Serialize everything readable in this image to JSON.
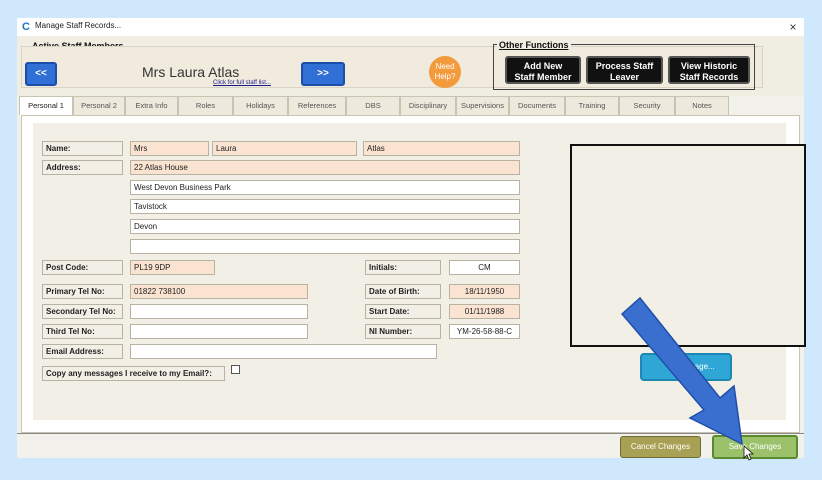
{
  "window": {
    "title": "Manage Staff Records...",
    "close_glyph": "×",
    "app_icon_glyph": "C"
  },
  "header": {
    "active_staff_label": "Active Staff Members",
    "prev_button": "<<",
    "next_button": ">>",
    "staff_name": "Mrs Laura Atlas",
    "full_list_link": "Click for full staff list...",
    "need_help_line1": "Need",
    "need_help_line2": "Help?",
    "other_functions_label": "Other Functions",
    "add_new_line1": "Add New",
    "add_new_line2": "Staff Member",
    "process_leaver_line1": "Process Staff",
    "process_leaver_line2": "Leaver",
    "historic_line1": "View Historic",
    "historic_line2": "Staff Records"
  },
  "tabs": [
    {
      "label": "Personal 1",
      "active": true
    },
    {
      "label": "Personal 2"
    },
    {
      "label": "Extra Info"
    },
    {
      "label": "Roles"
    },
    {
      "label": "Holidays"
    },
    {
      "label": "References"
    },
    {
      "label": "DBS"
    },
    {
      "label": "Disciplinary"
    },
    {
      "label": "Supervisions"
    },
    {
      "label": "Documents"
    },
    {
      "label": "Training"
    },
    {
      "label": "Security"
    },
    {
      "label": "Notes"
    }
  ],
  "form": {
    "name_label": "Name:",
    "title": "Mrs",
    "first_name": "Laura",
    "surname": "Atlas",
    "address_label": "Address:",
    "address1": "22 Atlas House",
    "address2": "West Devon Business Park",
    "address3": "Tavistock",
    "address4": "Devon",
    "address5": "",
    "postcode_label": "Post Code:",
    "postcode": "PL19 9DP",
    "initials_label": "Initials:",
    "initials": "CM",
    "primary_tel_label": "Primary Tel No:",
    "primary_tel": "01822 738100",
    "dob_label": "Date of Birth:",
    "dob": "18/11/1950",
    "secondary_tel_label": "Secondary Tel No:",
    "secondary_tel": "",
    "start_date_label": "Start Date:",
    "start_date": "01/11/1988",
    "third_tel_label": "Third Tel No:",
    "third_tel": "",
    "ni_label": "NI Number:",
    "ni_number": "YM-26-58-88-C",
    "email_label": "Email Address:",
    "email": "",
    "copy_messages_label": "Copy any messages I receive to my Email?:",
    "copy_messages_checked": false
  },
  "photo": {
    "change_image_button": "mage..."
  },
  "footer": {
    "cancel_button": "Cancel Changes",
    "save_button": "Save Changes"
  },
  "colors": {
    "nav_blue": "#2f6fd6",
    "peach_field": "#fbe3d1",
    "help_orange": "#f29a3c",
    "footer_olive": "#a8a054",
    "annotation_arrow": "#3a6fd0"
  }
}
